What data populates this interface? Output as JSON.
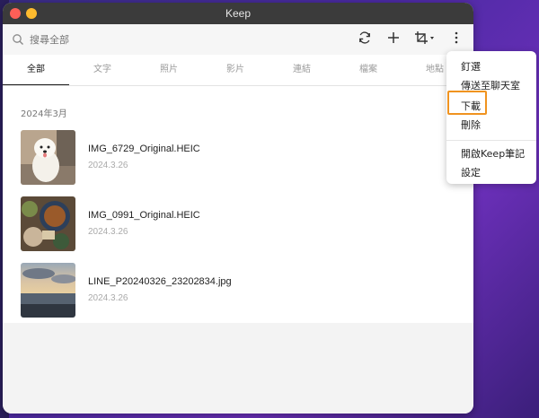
{
  "window": {
    "title": "Keep"
  },
  "search": {
    "placeholder": "搜尋全部"
  },
  "tabs": [
    {
      "label": "全部"
    },
    {
      "label": "文字"
    },
    {
      "label": "照片"
    },
    {
      "label": "影片"
    },
    {
      "label": "連結"
    },
    {
      "label": "檔案"
    },
    {
      "label": "地點"
    }
  ],
  "section": {
    "label": "2024年3月"
  },
  "files": [
    {
      "name": "IMG_6729_Original.HEIC",
      "date": "2024.3.26"
    },
    {
      "name": "IMG_0991_Original.HEIC",
      "date": "2024.3.26"
    },
    {
      "name": "LINE_P20240326_23202834.jpg",
      "date": "2024.3.26"
    }
  ],
  "menu": {
    "items": [
      {
        "label": "釘選"
      },
      {
        "label": "傳送至聊天室"
      },
      {
        "label": "下載"
      },
      {
        "label": "刪除"
      },
      {
        "label": "開啟Keep筆記"
      },
      {
        "label": "設定"
      }
    ]
  },
  "icons": {
    "search": "search-icon",
    "refresh": "refresh-icon",
    "add": "plus-icon",
    "crop": "crop-icon",
    "more": "more-vertical-icon"
  },
  "colors": {
    "highlight": "#f0931f",
    "titlebar": "#3b3b3b"
  }
}
